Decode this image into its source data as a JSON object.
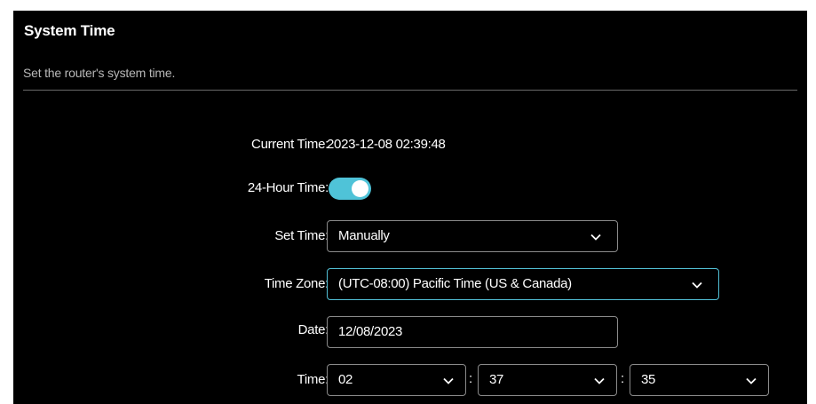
{
  "section": {
    "title": "System Time",
    "description": "Set the router's system time."
  },
  "form": {
    "current_time": {
      "label": "Current Time:",
      "value": "2023-12-08 02:39:48"
    },
    "hour24": {
      "label": "24-Hour Time:",
      "enabled": true,
      "accent_color": "#4fc3d8"
    },
    "set_time": {
      "label": "Set Time:",
      "selected": "Manually"
    },
    "time_zone": {
      "label": "Time Zone:",
      "selected": "(UTC-08:00) Pacific Time (US & Canada)"
    },
    "date": {
      "label": "Date:",
      "value": "12/08/2023"
    },
    "time": {
      "label": "Time:",
      "hour": "02",
      "minute": "37",
      "second": "35",
      "separator": ":"
    }
  },
  "icons": {
    "dropdown": "chevron-down-icon"
  }
}
